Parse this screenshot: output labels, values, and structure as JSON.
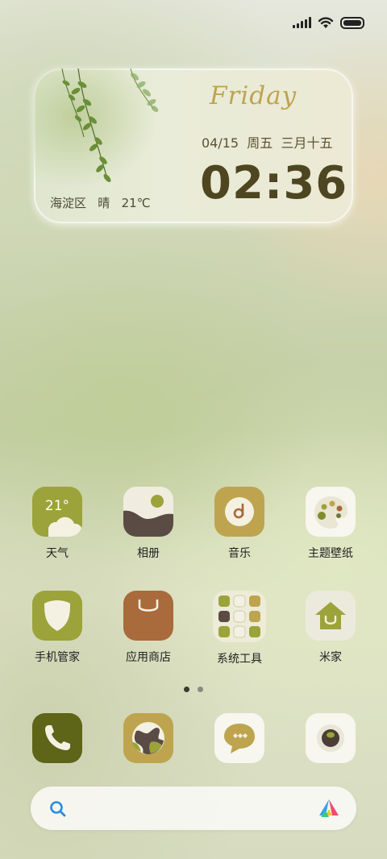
{
  "status_bar": {
    "icons": [
      "signal-icon",
      "wifi-icon",
      "battery-icon"
    ]
  },
  "widget": {
    "day": "Friday",
    "date": "04/15  周五  三月十五",
    "time": "02:36",
    "weather": "海淀区   晴   21℃"
  },
  "apps": [
    {
      "label": "天气",
      "icon": "weather-icon",
      "text": "21°"
    },
    {
      "label": "相册",
      "icon": "gallery-icon"
    },
    {
      "label": "音乐",
      "icon": "music-icon"
    },
    {
      "label": "主题壁纸",
      "icon": "palette-icon"
    },
    {
      "label": "手机管家",
      "icon": "shield-icon"
    },
    {
      "label": "应用商店",
      "icon": "store-bag-icon"
    },
    {
      "label": "系统工具",
      "icon": "folder-icon"
    },
    {
      "label": "米家",
      "icon": "home-icon"
    }
  ],
  "pager": {
    "pages": 2,
    "current": 1
  },
  "dock": [
    {
      "icon": "phone-icon"
    },
    {
      "icon": "browser-icon"
    },
    {
      "icon": "messages-icon"
    },
    {
      "icon": "camera-icon"
    }
  ],
  "search": {
    "icons": [
      "search-icon",
      "assistant-icon"
    ]
  },
  "colors": {
    "olive": "#9ba33a",
    "dark_olive": "#5e6418",
    "gold": "#bea44e",
    "brown": "#a96a3c"
  }
}
